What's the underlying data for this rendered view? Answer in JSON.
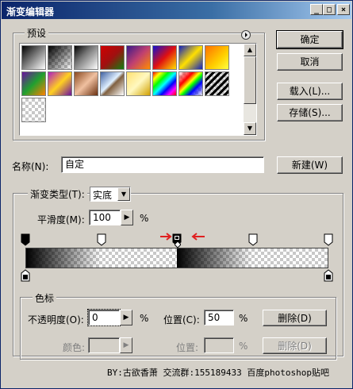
{
  "window": {
    "title": "渐变编辑器",
    "buttons": {
      "minimize": "_",
      "maximize": "□",
      "close": "×"
    }
  },
  "actions": {
    "ok": "确定",
    "cancel": "取消",
    "load": "载入(L)...",
    "save": "存储(S)...",
    "new": "新建(W)"
  },
  "presets": {
    "label": "预设",
    "menu_icon": "circle-arrow-icon",
    "swatches": [
      "black-to-white",
      "checker-black",
      "black-to-white-2",
      "red-green",
      "violet-orange",
      "blue-red-yellow",
      "blue-yellow-blue",
      "orange-yellow",
      "violet-green-orange",
      "yellow-violet-orange",
      "copper",
      "chrome",
      "yellow-gold",
      "spectrum",
      "transparent-rainbow",
      "transparent-stripes",
      "transparent"
    ]
  },
  "name": {
    "label": "名称(N):",
    "value": "自定"
  },
  "gradient": {
    "type_label": "渐变类型(T):",
    "type_value": "实底",
    "smoothness_label": "平滑度(M):",
    "smoothness_value": "100",
    "smoothness_unit": "%",
    "opacity_stops": [
      0,
      0.25,
      0.5,
      0.75,
      1
    ],
    "selected_opacity_stop": 0.5,
    "color_stops": [
      0,
      1
    ],
    "midpoint": 0.375
  },
  "stops": {
    "group_label": "色标",
    "opacity_label": "不透明度(O):",
    "opacity_value": "0",
    "opacity_unit": "%",
    "location_label": "位置(C):",
    "location_value": "50",
    "location_unit": "%",
    "delete": "删除(D)",
    "color_label": "颜色:",
    "color_location_label": "位置:",
    "color_location_unit": "%",
    "color_delete": "删除(D)"
  },
  "footer": "BY:古欲香萧   交流群:155189433  百度photoshop贴吧"
}
